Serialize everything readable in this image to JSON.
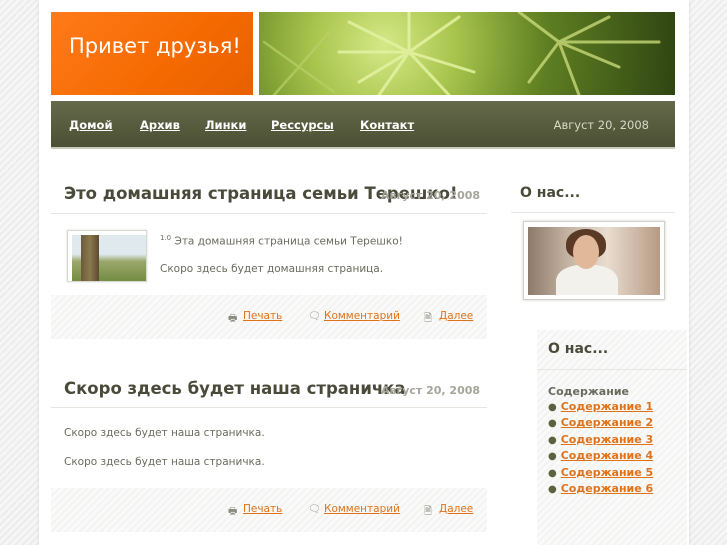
{
  "header": {
    "logo_text": "Привет друзья!",
    "nav": [
      "Домой",
      "Архив",
      "Линки",
      "Ресcурсы",
      "Контакт"
    ],
    "date": "Август 20, 2008"
  },
  "posts": [
    {
      "title": "Это домашняя страница семьи Терешко!",
      "date": "Август 20, 2008",
      "sup": "1.0",
      "line1": "Эта домашняя страница семьи Терешко!",
      "line2": "Скоро здесь будет домашняя страница.",
      "print": "Печать",
      "comment": "Комментарий",
      "more": "Далее"
    },
    {
      "title": "Скоро здесь будет наша страничка",
      "date": "Август 20, 2008",
      "line1": "Скоро здесь будет наша страничка.",
      "line2": "Скоро здесь будет наша страничка.",
      "print": "Печать",
      "comment": "Комментарий",
      "more": "Далее"
    }
  ],
  "sidebar": {
    "about_title": "О нас...",
    "about_title2": "О нас...",
    "contents_title": "Содержание",
    "items": [
      "Содержание 1",
      "Содержание 2",
      "Содержание 3",
      "Содержание 4",
      "Содержание 5",
      "Содержание 6"
    ]
  },
  "icons": {
    "print": "printer-icon",
    "comment": "comment-icon",
    "more": "page-icon"
  },
  "colors": {
    "accent": "#f56a00",
    "nav": "#55593c",
    "link": "#e0731a"
  }
}
